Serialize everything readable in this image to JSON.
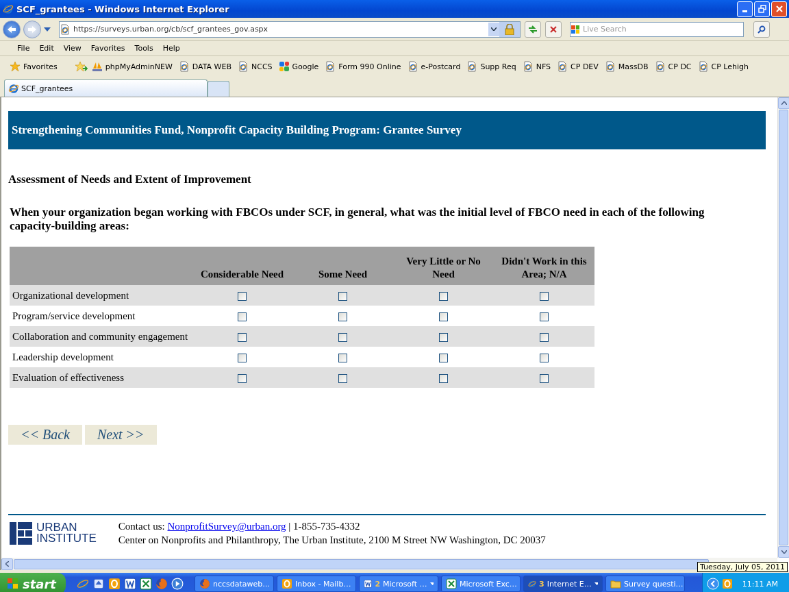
{
  "window": {
    "title": "SCF_grantees - Windows Internet Explorer"
  },
  "address_bar": {
    "url": "https://surveys.urban.org/cb/scf_grantees_gov.aspx",
    "secure": true
  },
  "search": {
    "placeholder": "Live Search"
  },
  "menu": [
    "File",
    "Edit",
    "View",
    "Favorites",
    "Tools",
    "Help"
  ],
  "favorites_bar": {
    "label": "Favorites",
    "links": [
      {
        "label": "phpMyAdminNEW",
        "kind": "pma"
      },
      {
        "label": "DATA WEB",
        "kind": "page"
      },
      {
        "label": "NCCS",
        "kind": "page"
      },
      {
        "label": "Google",
        "kind": "google"
      },
      {
        "label": "Form 990 Online",
        "kind": "page"
      },
      {
        "label": "e-Postcard",
        "kind": "page"
      },
      {
        "label": "Supp Req",
        "kind": "page"
      },
      {
        "label": "NFS",
        "kind": "page"
      },
      {
        "label": "CP DEV",
        "kind": "page"
      },
      {
        "label": "MassDB",
        "kind": "page"
      },
      {
        "label": "CP DC",
        "kind": "page"
      },
      {
        "label": "CP Lehigh",
        "kind": "page"
      }
    ]
  },
  "tabs": [
    {
      "label": "SCF_grantees",
      "selected": true
    }
  ],
  "survey": {
    "banner": "Strengthening Communities Fund, Nonprofit Capacity Building Program: Grantee Survey",
    "section_title": "Assessment of Needs and Extent of Improvement",
    "question": "When your organization began working with FBCOs under SCF, in general, what was the initial level of FBCO need in each of the following capacity-building areas:",
    "columns": [
      "Considerable Need",
      "Some Need",
      "Very Little or No Need",
      "Didn't Work in this Area; N/A"
    ],
    "rows": [
      {
        "label": "Organizational development",
        "checked": [
          false,
          false,
          false,
          false
        ]
      },
      {
        "label": "Program/service development",
        "checked": [
          false,
          false,
          false,
          false
        ]
      },
      {
        "label": "Collaboration and community engagement",
        "checked": [
          false,
          false,
          false,
          false
        ]
      },
      {
        "label": "Leadership development",
        "checked": [
          false,
          false,
          false,
          false
        ]
      },
      {
        "label": "Evaluation of effectiveness",
        "checked": [
          false,
          false,
          false,
          false
        ]
      }
    ],
    "buttons": [
      "<< Back",
      "Next >>"
    ]
  },
  "footer": {
    "logo": [
      "URBAN",
      "INSTITUTE"
    ],
    "contact_prefix": "Contact us:",
    "email": "NonprofitSurvey@urban.org",
    "contact_suffix": "| 1-855-735-4332",
    "address": "Center on Nonprofits and Philanthropy, The Urban Institute, 2100 M Street NW Washington, DC 20037"
  },
  "taskbar": {
    "start": "start",
    "quick_launch": [
      {
        "kind": "ie"
      },
      {
        "kind": "refresh"
      },
      {
        "kind": "outlook"
      },
      {
        "kind": "word"
      },
      {
        "kind": "excel"
      },
      {
        "kind": "firefox"
      },
      {
        "kind": "media"
      }
    ],
    "tasks": [
      {
        "kind": "firefox",
        "label": "nccsdataweb…",
        "grouped": false,
        "selected": false
      },
      {
        "kind": "outlook",
        "label": "Inbox - Mailb…",
        "grouped": false,
        "selected": false
      },
      {
        "kind": "word",
        "count": "2",
        "label": "Microsoft …",
        "grouped": true,
        "selected": false
      },
      {
        "kind": "excel",
        "label": "Microsoft Exc…",
        "grouped": false,
        "selected": false
      },
      {
        "kind": "ie",
        "count": "3",
        "label": "Internet E…",
        "grouped": true,
        "selected": true
      },
      {
        "kind": "folder",
        "label": "Survey questi…",
        "grouped": false,
        "selected": false
      }
    ],
    "clock": "11:11 AM",
    "tooltip": "Tuesday, July 05, 2011"
  }
}
